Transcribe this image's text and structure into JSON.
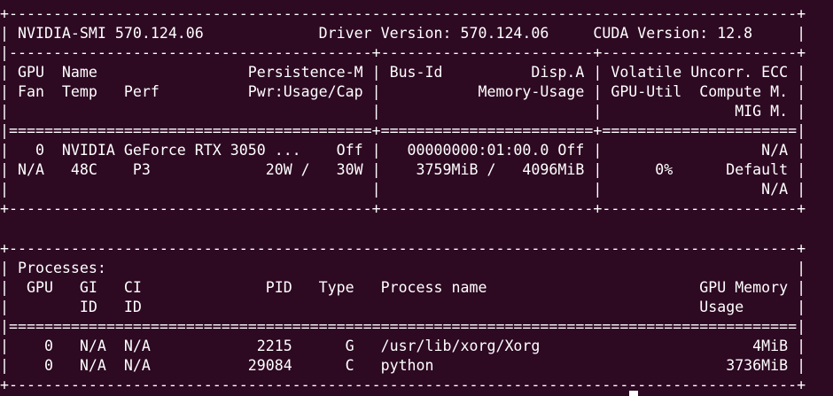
{
  "terminal": {
    "background_color": "#2d0922",
    "text_color": "#ffffff",
    "lines": [
      "+-----------------------------------------------------------------------------------------+",
      "| NVIDIA-SMI 570.124.06             Driver Version: 570.124.06     CUDA Version: 12.8     |",
      "|-----------------------------------------+------------------------+----------------------+",
      "| GPU  Name                 Persistence-M | Bus-Id          Disp.A | Volatile Uncorr. ECC |",
      "| Fan  Temp   Perf          Pwr:Usage/Cap |           Memory-Usage | GPU-Util  Compute M. |",
      "|                                         |                        |               MIG M. |",
      "|=========================================+========================+======================|",
      "|   0  NVIDIA GeForce RTX 3050 ...    Off |   00000000:01:00.0 Off |                  N/A |",
      "| N/A   48C    P3             20W /   30W |    3759MiB /   4096MiB |      0%      Default |",
      "|                                         |                        |                  N/A |",
      "+-----------------------------------------+------------------------+----------------------+",
      "",
      "+-----------------------------------------------------------------------------------------+",
      "| Processes:                                                                              |",
      "|  GPU   GI   CI              PID   Type   Process name                        GPU Memory |",
      "|        ID   ID                                                               Usage      |",
      "|=========================================================================================|",
      "|    0   N/A  N/A            2215      G   /usr/lib/xorg/Xorg                        4MiB |",
      "|    0   N/A  N/A           29084      C   python                                 3736MiB |",
      "+-----------------------------------------------------------------------------------------+"
    ]
  }
}
